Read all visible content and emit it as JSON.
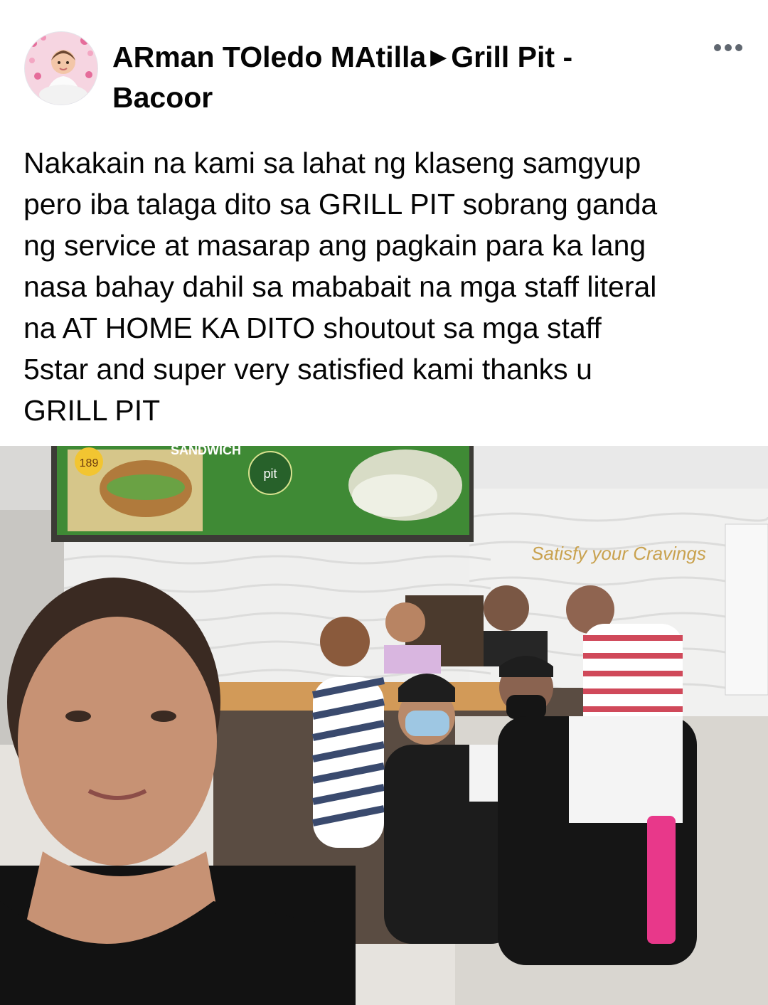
{
  "post": {
    "author": "ARman TOledo MAtilla",
    "page": "Grill Pit - Bacoor",
    "body": "Nakakain na kami sa lahat ng klaseng samgyup\npero iba talaga dito sa GRILL PIT sobrang ganda\nng service at masarap ang pagkain para ka lang\nnasa bahay dahil sa mababait na mga staff literal\nna AT HOME KA DITO shoutout sa mga staff\n5star and super very satisfied kami thanks u\nGRILL PIT"
  },
  "icons": {
    "more": "more-horizontal-icon",
    "arrow": "triangle-right-icon",
    "avatar": "profile-avatar"
  },
  "photo": {
    "wall_sign": "Satisfy your Cravings",
    "menu_sign": "SANDWICH",
    "menu_price": "189",
    "menu_logo": "pit"
  },
  "colors": {
    "text": "#050505",
    "secondary": "#606770",
    "menu_board": "#2d7a2c"
  }
}
